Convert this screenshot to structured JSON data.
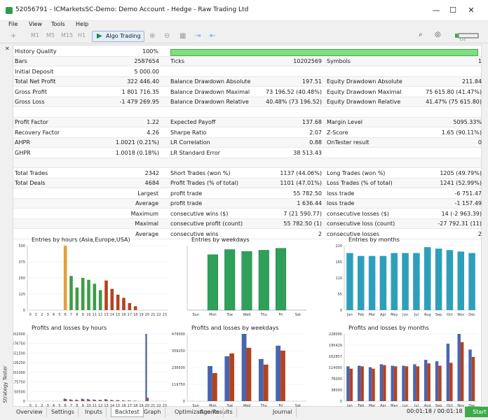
{
  "window": {
    "title": "52056791 - ICMarketsSC-Demo: Demo Account - Hedge - Raw Trading Ltd",
    "minimize": "—",
    "maximize": "☐",
    "close": "✕"
  },
  "menu": [
    "File",
    "View",
    "Tools",
    "Help"
  ],
  "toolbar": {
    "timeframes": [
      "M1",
      "M5",
      "M15",
      "H1"
    ],
    "algo_label": "Algo Trading",
    "algo_icon": "play-icon",
    "signal_label": "LTE"
  },
  "side_tab": "Strategy Tester",
  "close_icon": "✕",
  "history": {
    "label": "History Quality",
    "value": "100%",
    "fill": 1.0
  },
  "stats_rows": [
    [
      [
        "Bars",
        "2587654"
      ],
      [
        "Ticks",
        "10202569"
      ],
      [
        "Symbols",
        "1"
      ]
    ],
    [
      [
        "Initial Deposit",
        "5 000.00"
      ],
      [
        "",
        ""
      ],
      [
        "",
        ""
      ]
    ],
    [
      [
        "Total Net Profit",
        "322 446.40"
      ],
      [
        "Balance Drawdown Absolute",
        "197.51"
      ],
      [
        "Equity Drawdown Absolute",
        "211.84"
      ]
    ],
    [
      [
        "Gross Profit",
        "1 801 716.35"
      ],
      [
        "Balance Drawdown Maximal",
        "73 196.52 (40.48%)"
      ],
      [
        "Equity Drawdown Maximal",
        "75 615.80 (41.47%)"
      ]
    ],
    [
      [
        "Gross Loss",
        "-1 479 269.95"
      ],
      [
        "Balance Drawdown Relative",
        "40.48% (73 196.52)"
      ],
      [
        "Equity Drawdown Relative",
        "41.47% (75 615.80)"
      ]
    ],
    [
      [
        "",
        ""
      ],
      [
        "",
        ""
      ],
      [
        "",
        ""
      ]
    ],
    [
      [
        "Profit Factor",
        "1.22"
      ],
      [
        "Expected Payoff",
        "137.68"
      ],
      [
        "Margin Level",
        "5095.33%"
      ]
    ],
    [
      [
        "Recovery Factor",
        "4.26"
      ],
      [
        "Sharpe Ratio",
        "2.07"
      ],
      [
        "Z-Score",
        "1.65 (90.11%)"
      ]
    ],
    [
      [
        "AHPR",
        "1.0021 (0.21%)"
      ],
      [
        "LR Correlation",
        "0.88"
      ],
      [
        "OnTester result",
        "0"
      ]
    ],
    [
      [
        "GHPR",
        "1.0018 (0.18%)"
      ],
      [
        "LR Standard Error",
        "38 513.43"
      ],
      [
        "",
        ""
      ]
    ],
    [
      [
        "",
        ""
      ],
      [
        "",
        ""
      ],
      [
        "",
        ""
      ]
    ],
    [
      [
        "Total Trades",
        "2342"
      ],
      [
        "Short Trades (won %)",
        "1137 (44.06%)"
      ],
      [
        "Long Trades (won %)",
        "1205 (49.79%)"
      ]
    ],
    [
      [
        "Total Deals",
        "4684"
      ],
      [
        "Profit Trades (% of total)",
        "1101 (47.01%)"
      ],
      [
        "Loss Trades (% of total)",
        "1241 (52.99%)"
      ]
    ],
    [
      [
        "Largest",
        ""
      ],
      [
        "profit trade",
        "55 782.50"
      ],
      [
        "loss trade",
        "-6 751.47"
      ]
    ],
    [
      [
        "Average",
        ""
      ],
      [
        "profit trade",
        "1 636.44"
      ],
      [
        "loss trade",
        "-1 157.49"
      ]
    ],
    [
      [
        "Maximum",
        ""
      ],
      [
        "consecutive wins ($)",
        "7 (21 590.77)"
      ],
      [
        "consecutive losses ($)",
        "14 (-2 963.39)"
      ]
    ],
    [
      [
        "Maximal",
        ""
      ],
      [
        "consecutive profit (count)",
        "55 782.50 (1)"
      ],
      [
        "consecutive loss (count)",
        "-27 792.31 (11)"
      ]
    ],
    [
      [
        "Average",
        ""
      ],
      [
        "consecutive wins",
        "2"
      ],
      [
        "consecutive losses",
        "2"
      ]
    ]
  ],
  "colors": {
    "bar_green": "#3f9b46",
    "bar_red": "#b5421f",
    "bar_orange": "#e3a03a",
    "bar_blue": "#4865b0",
    "week_green": "#2fa05a",
    "month_teal": "#2e9fbb"
  },
  "chart_data": [
    {
      "type": "bar",
      "title": "Entries by hours (Asia,Europe,USA)",
      "categories": [
        "0",
        "1",
        "2",
        "3",
        "4",
        "5",
        "6",
        "7",
        "8",
        "9",
        "10",
        "11",
        "12",
        "13",
        "14",
        "15",
        "16",
        "17",
        "18",
        "19",
        "20",
        "21",
        "22",
        "23"
      ],
      "values": [
        0,
        0,
        0,
        0,
        0,
        0,
        520,
        265,
        175,
        250,
        235,
        205,
        155,
        230,
        165,
        120,
        95,
        55,
        30,
        0,
        0,
        0,
        0,
        0
      ],
      "ylim": [
        0,
        500
      ],
      "yticks": [
        "500",
        "375",
        "250",
        "125",
        "0"
      ],
      "xticks": [
        "0",
        "1",
        "2",
        "3",
        "4",
        "5",
        "6",
        "7",
        "8",
        "9",
        "10",
        "11",
        "12",
        "13",
        "14",
        "15",
        "16",
        "17",
        "18",
        "19",
        "20",
        "21",
        "22",
        "23"
      ]
    },
    {
      "type": "bar",
      "title": "Entries by weekdays",
      "categories": [
        "Sun",
        "Mon",
        "Tue",
        "Wed",
        "Thu",
        "Fri",
        "Sat"
      ],
      "values": [
        0,
        430,
        470,
        455,
        465,
        480,
        0
      ],
      "ylim": [
        0,
        500
      ],
      "yticks": [],
      "xticks": [
        "Sun",
        "Mon",
        "Tue",
        "Wed",
        "Thu",
        "Fri",
        "Sat"
      ]
    },
    {
      "type": "bar",
      "title": "Entries by months",
      "categories": [
        "Jan",
        "Feb",
        "Mar",
        "Apr",
        "May",
        "Jun",
        "Jul",
        "Aug",
        "Sep",
        "Oct",
        "Nov",
        "Dec"
      ],
      "values": [
        195,
        185,
        185,
        185,
        195,
        195,
        195,
        215,
        210,
        205,
        200,
        195
      ],
      "ylim": [
        0,
        220
      ],
      "yticks": [
        "220",
        "165",
        "110",
        "55",
        "0"
      ],
      "xticks": [
        "Jan",
        "Feb",
        "Mar",
        "Apr",
        "May",
        "Jun",
        "Jul",
        "Aug",
        "Sep",
        "Oct",
        "Nov",
        "Dec"
      ]
    },
    {
      "type": "bar",
      "title": "Profits and losses by hours",
      "categories": [
        "0",
        "1",
        "2",
        "3",
        "4",
        "5",
        "6",
        "7",
        "8",
        "9",
        "10",
        "11",
        "12",
        "13",
        "14",
        "15",
        "16",
        "17",
        "18",
        "19",
        "20",
        "21",
        "22",
        "23"
      ],
      "series": [
        {
          "values": [
            0,
            0,
            0,
            0,
            0,
            0,
            30000,
            22000,
            18000,
            30000,
            26000,
            20000,
            15000,
            24000,
            15000,
            12000,
            10000,
            8000,
            5000,
            0,
            802000,
            0,
            0,
            0
          ]
        },
        {
          "values": [
            0,
            0,
            0,
            0,
            0,
            0,
            25000,
            15000,
            12000,
            22000,
            18000,
            14000,
            12000,
            18000,
            10000,
            9000,
            6000,
            5000,
            3000,
            0,
            40000,
            0,
            0,
            0
          ]
        }
      ],
      "ylim": [
        0,
        802000
      ],
      "yticks": [
        "802000",
        "676750",
        "551500",
        "426250",
        "301000",
        "175750",
        "50500",
        "0"
      ],
      "xticks": [
        "0",
        "1",
        "2",
        "3",
        "4",
        "5",
        "6",
        "7",
        "8",
        "9",
        "10",
        "11",
        "12",
        "13",
        "14",
        "15",
        "16",
        "17",
        "18",
        "19",
        "20",
        "21",
        "22",
        "23"
      ]
    },
    {
      "type": "bar",
      "title": "Profits and losses by weekdays",
      "categories": [
        "Sun",
        "Mon",
        "Tue",
        "Wed",
        "Thu",
        "Fri",
        "Sat"
      ],
      "series": [
        {
          "values": [
            0,
            250000,
            320000,
            479000,
            300000,
            395000,
            0
          ]
        },
        {
          "values": [
            0,
            200000,
            340000,
            380000,
            260000,
            360000,
            0
          ]
        }
      ],
      "ylim": [
        0,
        479000
      ],
      "yticks": [
        "479000",
        "359250",
        "239500",
        "119750",
        "0"
      ],
      "xticks": [
        "Sun",
        "Mon",
        "Tue",
        "Wed",
        "Thu",
        "Fri",
        "Sat"
      ]
    },
    {
      "type": "bar",
      "title": "Profits and losses by months",
      "categories": [
        "Jan",
        "Feb",
        "Mar",
        "Apr",
        "May",
        "Jun",
        "Jul",
        "Aug",
        "Sep",
        "Oct",
        "Nov",
        "Dec"
      ],
      "series": [
        {
          "values": [
            118000,
            120000,
            115000,
            125000,
            120000,
            120000,
            125000,
            140000,
            135000,
            195000,
            228000,
            175000
          ]
        },
        {
          "values": [
            110000,
            118000,
            110000,
            122000,
            118000,
            118000,
            118000,
            128000,
            120000,
            130000,
            200000,
            150000
          ]
        }
      ],
      "ylim": [
        0,
        228000
      ],
      "yticks": [
        "228000",
        "195429",
        "162857",
        "114000",
        "76000",
        "38000",
        "0"
      ],
      "xticks": [
        "Jan",
        "Feb",
        "Mar",
        "Apr",
        "May",
        "Jun",
        "Jul",
        "Aug",
        "Sep",
        "Oct",
        "Nov",
        "Dec"
      ]
    }
  ],
  "bottom_tabs": [
    "Overview",
    "Settings",
    "Inputs",
    "Backtest",
    "Graph",
    "Optimization Results",
    "Agents",
    "Journal"
  ],
  "active_tab": "Backtest",
  "timer": "00:01:18 / 00:01:18",
  "start_label": "Start"
}
